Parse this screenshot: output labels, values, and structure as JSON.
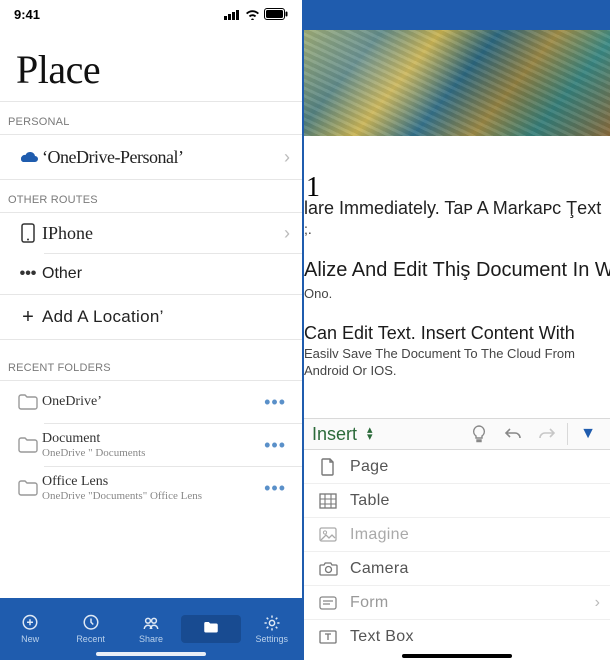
{
  "status": {
    "time": "9:41"
  },
  "title": "Place",
  "sections": {
    "personal": "PERSONAL",
    "other_routes": "OTHER ROUTES",
    "recent_folders": "RECENT FOLDERS"
  },
  "personal": {
    "onedrive_label": "‘OneDrive-Personal’"
  },
  "other_routes": {
    "iphone_label": "IPhone",
    "other_label": "Other",
    "add_location_label": "Add A Location’"
  },
  "recent": [
    {
      "name": "OneDrive’",
      "path": ""
    },
    {
      "name": "Document",
      "path": "OneDrive \" Documents"
    },
    {
      "name": "Office Lens",
      "path": "OneDrive \"Documents\" Office Lens"
    }
  ],
  "tabs": {
    "new": "New",
    "recent": "Recent",
    "share": "Share",
    "files": "",
    "settings": "Settings"
  },
  "doc": {
    "gutter": "1",
    "l1": "lare Immediately. Taᴘ A Markaᴘc Ţext",
    "l2": ";.",
    "l3": "Alize And Edit Thiş Document In Wo",
    "l4": "Ono.",
    "l5": "Can Edit Text. Insert Content With",
    "l6": "Easilv Save The Document To The Cloud From",
    "l7": "Android Or IOS."
  },
  "ribbon": {
    "name": "Insert",
    "items": {
      "page": "Paɡe",
      "table": "Table",
      "image": "Imaɡine",
      "camera": "Camera",
      "form": "Form",
      "textbox": "Text Box"
    }
  }
}
